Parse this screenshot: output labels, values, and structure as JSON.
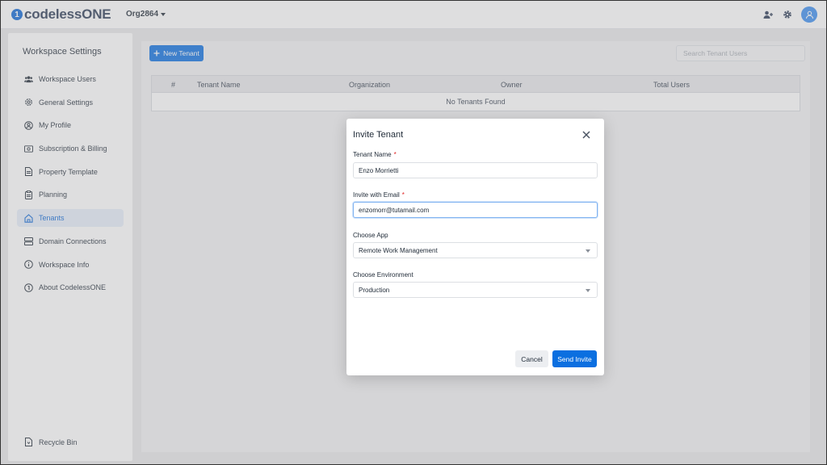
{
  "app": {
    "logo_text": "codelessONE",
    "org": "Org2864"
  },
  "topbar": {
    "icons": [
      "add-user-icon",
      "gear-icon",
      "user-avatar-icon"
    ]
  },
  "sidebar": {
    "title": "Workspace Settings",
    "items": [
      {
        "label": "Workspace Users",
        "icon": "users-icon"
      },
      {
        "label": "General Settings",
        "icon": "gear-icon"
      },
      {
        "label": "My Profile",
        "icon": "profile-icon"
      },
      {
        "label": "Subscription & Billing",
        "icon": "billing-icon"
      },
      {
        "label": "Property Template",
        "icon": "document-icon"
      },
      {
        "label": "Planning",
        "icon": "clipboard-icon"
      },
      {
        "label": "Tenants",
        "icon": "home-icon",
        "active": true
      },
      {
        "label": "Domain Connections",
        "icon": "server-icon"
      },
      {
        "label": "Workspace Info",
        "icon": "info-icon"
      },
      {
        "label": "About CodelessONE",
        "icon": "logo-icon"
      }
    ],
    "recycle_bin": "Recycle Bin"
  },
  "main": {
    "new_tenant_label": "New Tenant",
    "search_placeholder": "Search Tenant Users",
    "table": {
      "columns": [
        "#",
        "Tenant Name",
        "Organization",
        "Owner",
        "Total Users"
      ],
      "empty_text": "No Tenants Found"
    }
  },
  "modal": {
    "title": "Invite Tenant",
    "tenant_name_label": "Tenant Name",
    "tenant_name_value": "Enzo Morrietti",
    "email_label": "Invite with Email",
    "email_value": "enzomorr@tutamail.com",
    "app_label": "Choose App",
    "app_value": "Remote Work Management",
    "env_label": "Choose Environment",
    "env_value": "Production",
    "required_mark": "*",
    "cancel_label": "Cancel",
    "send_label": "Send Invite"
  },
  "colors": {
    "accent": "#0b6fe0",
    "active_bg": "#e6eefa",
    "required": "#e02424"
  }
}
